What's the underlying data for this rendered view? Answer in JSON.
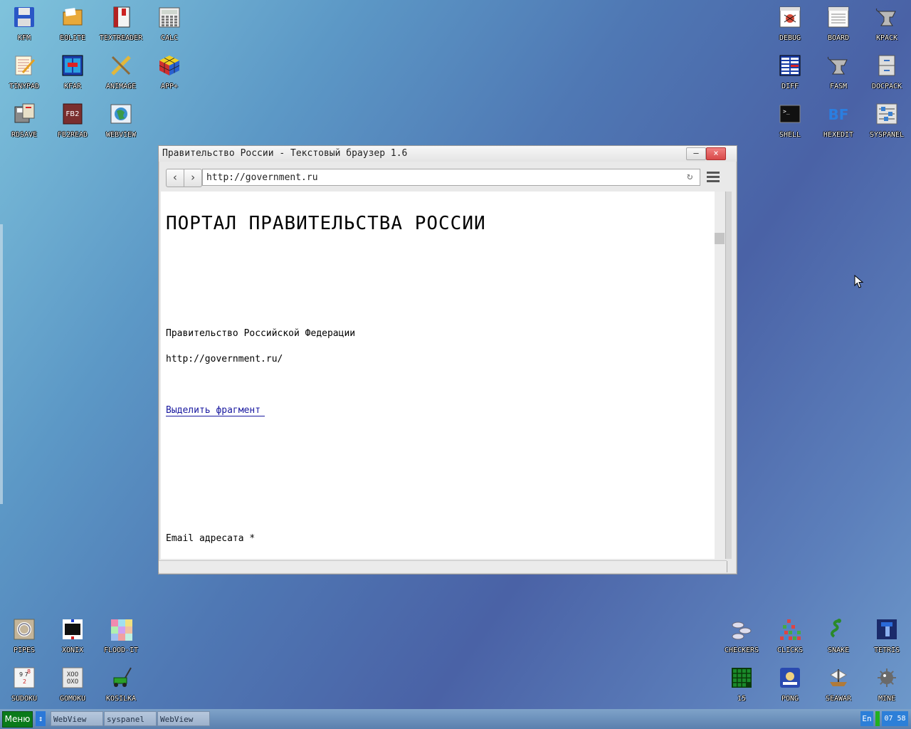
{
  "desktop": {
    "icons_top_left": [
      {
        "label": "KFM",
        "icon": "floppy-disk-icon",
        "color": "#2a57c6"
      },
      {
        "label": "EOLITE",
        "icon": "folder-icon",
        "color": "#e9a93a"
      },
      {
        "label": "TEXTREADER",
        "icon": "book-icon",
        "color": "#b22222"
      },
      {
        "label": "CALC",
        "icon": "calculator-icon",
        "color": "#9aa0a6"
      },
      {
        "label": "TINYPAD",
        "icon": "notepad-icon",
        "color": "#e8d7a3"
      },
      {
        "label": "KFAR",
        "icon": "file-manager-icon",
        "color": "#1a3ea8"
      },
      {
        "label": "ANIMAGE",
        "icon": "paint-pencil-icon",
        "color": "#e2b73b"
      },
      {
        "label": "APP+",
        "icon": "rubik-cube-icon",
        "color": "#cc3333"
      },
      {
        "label": "RDSAVE",
        "icon": "disk-save-icon",
        "color": "#8a8a8a"
      },
      {
        "label": "FB2READ",
        "icon": "fb2-book-icon",
        "color": "#7a2e2e"
      },
      {
        "label": "WEBVIEW",
        "icon": "globe-window-icon",
        "color": "#3a9a48"
      }
    ],
    "icons_top_right": [
      {
        "label": "DEBUG",
        "icon": "bug-window-icon",
        "color": "#d64c3a"
      },
      {
        "label": "BOARD",
        "icon": "clipboard-window-icon",
        "color": "#c8c8c8"
      },
      {
        "label": "KPACK",
        "icon": "anvil-icon",
        "color": "#9a9a9a"
      },
      {
        "label": "DIFF",
        "icon": "diff-grid-icon",
        "color": "#1a3ea8"
      },
      {
        "label": "FASM",
        "icon": "anvil-icon",
        "color": "#9a9a9a"
      },
      {
        "label": "DOCPACK",
        "icon": "cabinet-icon",
        "color": "#dcdcdc"
      },
      {
        "label": "SHELL",
        "icon": "terminal-icon",
        "color": "#111111"
      },
      {
        "label": "HEXEDIT",
        "icon": "hexedit-bf-icon",
        "color": "#2b7ee0"
      },
      {
        "label": "SYSPANEL",
        "icon": "sliders-icon",
        "color": "#e2e2e2"
      }
    ],
    "icons_bottom_left": [
      {
        "label": "PIPES",
        "icon": "pipes-icon",
        "color": "#c4b59a"
      },
      {
        "label": "XONIX",
        "icon": "xonix-icon",
        "color": "#101010"
      },
      {
        "label": "FLOOD-IT",
        "icon": "color-grid-icon",
        "color": "#f0a0c0"
      },
      {
        "label": "SUDOKU",
        "icon": "sudoku-icon",
        "color": "#f4f4f4"
      },
      {
        "label": "GOMOKU",
        "icon": "tic-tac-toe-icon",
        "color": "#e8e8e8"
      },
      {
        "label": "KOSILKA",
        "icon": "lawn-mower-icon",
        "color": "#2aa02a"
      }
    ],
    "icons_bottom_right": [
      {
        "label": "CHECKERS",
        "icon": "checkers-icon",
        "color": "#c0c8d8"
      },
      {
        "label": "CLICKS",
        "icon": "blocks-icon",
        "color": "#d84848"
      },
      {
        "label": "SNAKE",
        "icon": "snake-icon",
        "color": "#2a8a2a"
      },
      {
        "label": "TETRIS",
        "icon": "tetris-icon",
        "color": "#2a6ad8"
      },
      {
        "label": "15",
        "icon": "fifteen-grid-icon",
        "color": "#1a8a2a"
      },
      {
        "label": "PONG",
        "icon": "pong-icon",
        "color": "#2a4ab0"
      },
      {
        "label": "SEAWAR",
        "icon": "ship-icon",
        "color": "#b07a3a"
      },
      {
        "label": "MINE",
        "icon": "mine-icon",
        "color": "#6a6a6a"
      }
    ]
  },
  "window": {
    "title": "Правительство России - Текстовый браузер 1.6",
    "minimize_label": "–",
    "close_label": "×",
    "url": "http://government.ru",
    "content": {
      "heading": "ПОРТАЛ ПРАВИТЕЛЬСТВА РОССИИ",
      "line1": "Правительство Российской Федерации",
      "line2": "http://government.ru/",
      "link": "Выделить фрагмент",
      "email_label": "Email адресата *"
    }
  },
  "taskbar": {
    "menu_label": "Меню",
    "tasks": [
      "WebView",
      "syspanel",
      "WebView"
    ],
    "lang": "En",
    "clock": "07 58"
  }
}
